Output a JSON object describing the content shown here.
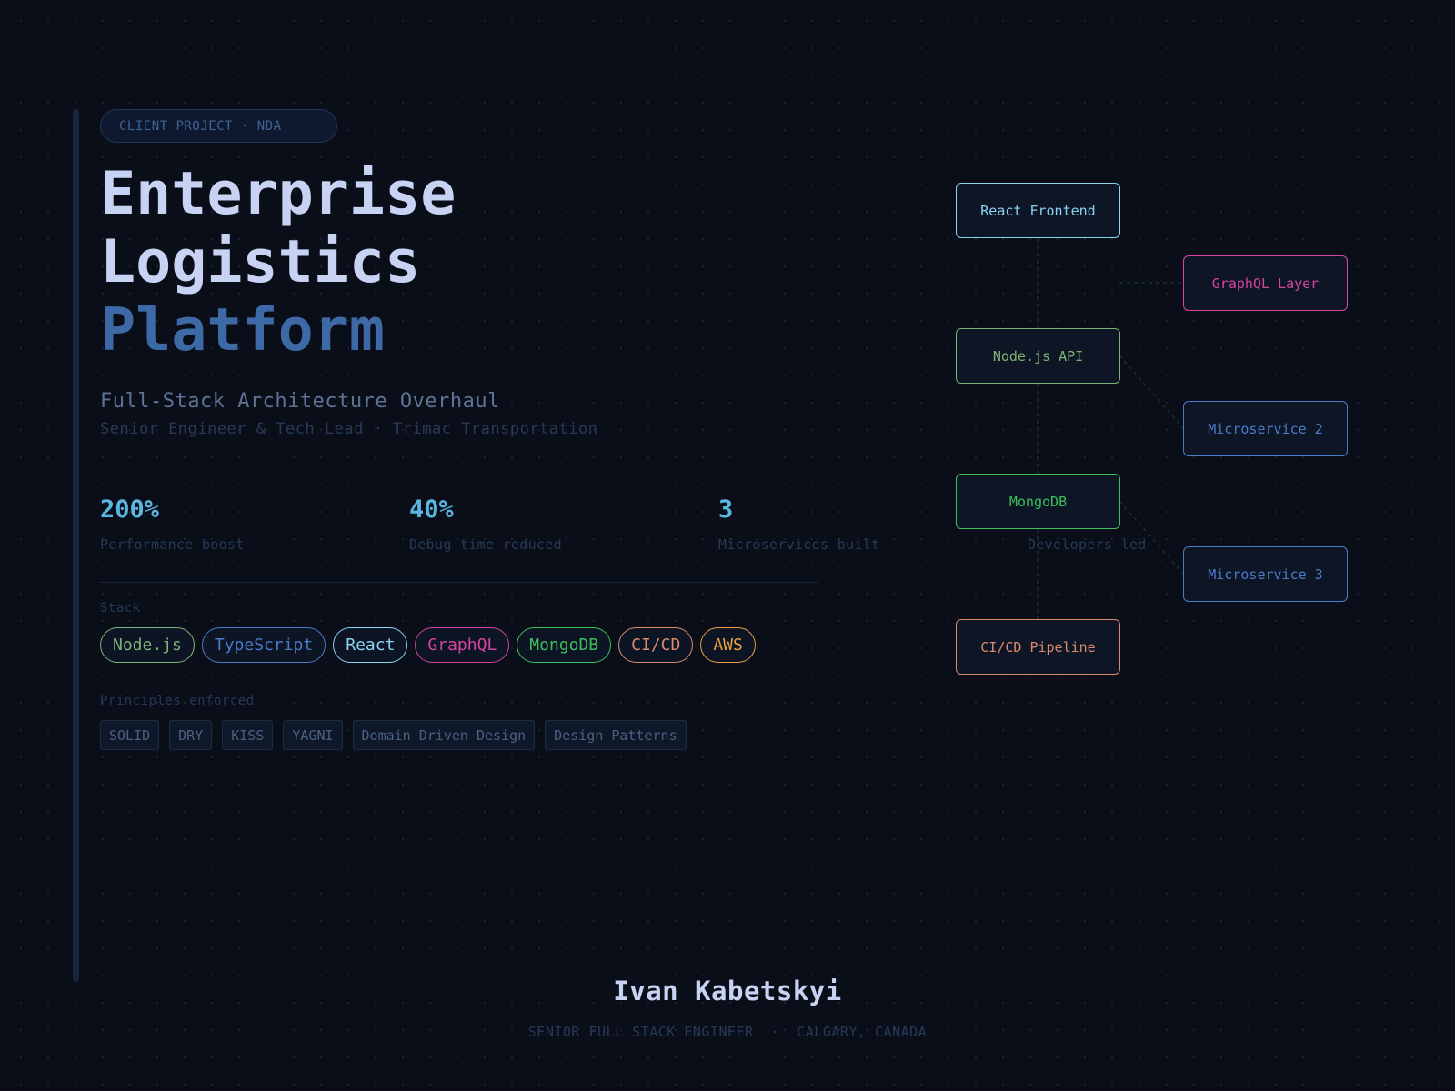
{
  "badge": "CLIENT PROJECT · NDA",
  "title": {
    "line1": "Enterprise",
    "line2": "Logistics",
    "line3": "Platform"
  },
  "subtitle": "Full-Stack Architecture Overhaul",
  "role": "Senior Engineer & Tech Lead · Trimac Transportation",
  "stats": [
    {
      "value": "200%",
      "label": "Performance boost"
    },
    {
      "value": "40%",
      "label": "Debug time reduced"
    },
    {
      "value": "3",
      "label": "Microservices built"
    },
    {
      "value": "",
      "label": "Developers led"
    }
  ],
  "stack": {
    "label": "Stack",
    "items": [
      {
        "label": "Node.js",
        "color": "#7fb276"
      },
      {
        "label": "TypeScript",
        "color": "#4a7ac8"
      },
      {
        "label": "React",
        "color": "#8ad4f2"
      },
      {
        "label": "GraphQL",
        "color": "#d6449f"
      },
      {
        "label": "MongoDB",
        "color": "#3cc05c"
      },
      {
        "label": "CI/CD",
        "color": "#d98a6e"
      },
      {
        "label": "AWS",
        "color": "#e8a040"
      }
    ]
  },
  "principles": {
    "label": "Principles enforced",
    "items": [
      "SOLID",
      "DRY",
      "KISS",
      "YAGNI",
      "Domain Driven Design",
      "Design Patterns"
    ]
  },
  "diagram": {
    "nodes": [
      {
        "label": "React Frontend",
        "color": "#8ad4f2"
      },
      {
        "label": "GraphQL Layer",
        "color": "#d6449f"
      },
      {
        "label": "Node.js API",
        "color": "#7fb276"
      },
      {
        "label": "Microservice 2",
        "color": "#4a7ac8"
      },
      {
        "label": "MongoDB",
        "color": "#3cc05c"
      },
      {
        "label": "Microservice 3",
        "color": "#4a7ac8"
      },
      {
        "label": "CI/CD Pipeline",
        "color": "#d98a6e"
      }
    ]
  },
  "footer": {
    "name": "Ivan Kabetskyi",
    "meta": "SENIOR FULL STACK ENGINEER  ·  CALGARY, CANADA"
  },
  "colors": {
    "background": "#0a0e19",
    "accent": "#3d69a6",
    "stat": "#5ab8e0"
  }
}
